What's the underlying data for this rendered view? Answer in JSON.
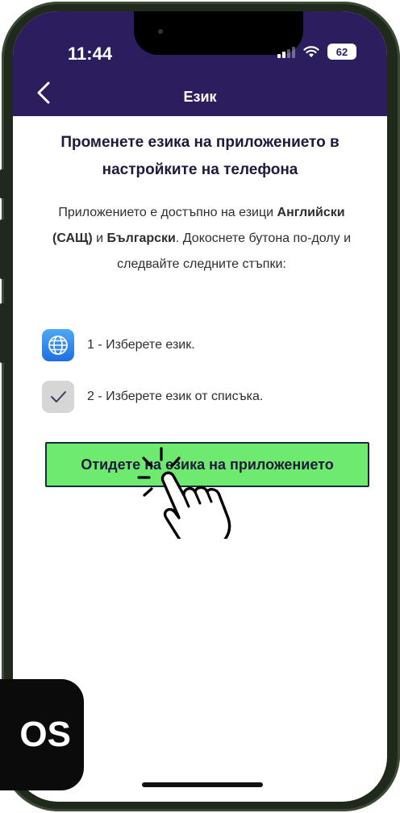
{
  "status_bar": {
    "time": "11:44",
    "battery": "62"
  },
  "nav": {
    "title": "Език"
  },
  "content": {
    "heading": "Променете езика на приложението в настройките на телефона",
    "body_part1": "Приложението е достъпно на езици ",
    "body_bold1": "Английски (САЩ)",
    "body_part2": " и ",
    "body_bold2": "Български",
    "body_part3": ". Докоснете бутона по-долу и следвайте следните стъпки:",
    "steps": [
      {
        "icon": "globe-icon",
        "text": "1 - Изберете език."
      },
      {
        "icon": "checkmark-icon",
        "text": "2 - Изберете език от списъка."
      }
    ],
    "cta_label": "Отидете на езика на приложението"
  },
  "badge": {
    "label": "OS"
  },
  "colors": {
    "header": "#2b1d5e",
    "cta": "#6eea6e",
    "text_dark": "#1f1a3d"
  }
}
